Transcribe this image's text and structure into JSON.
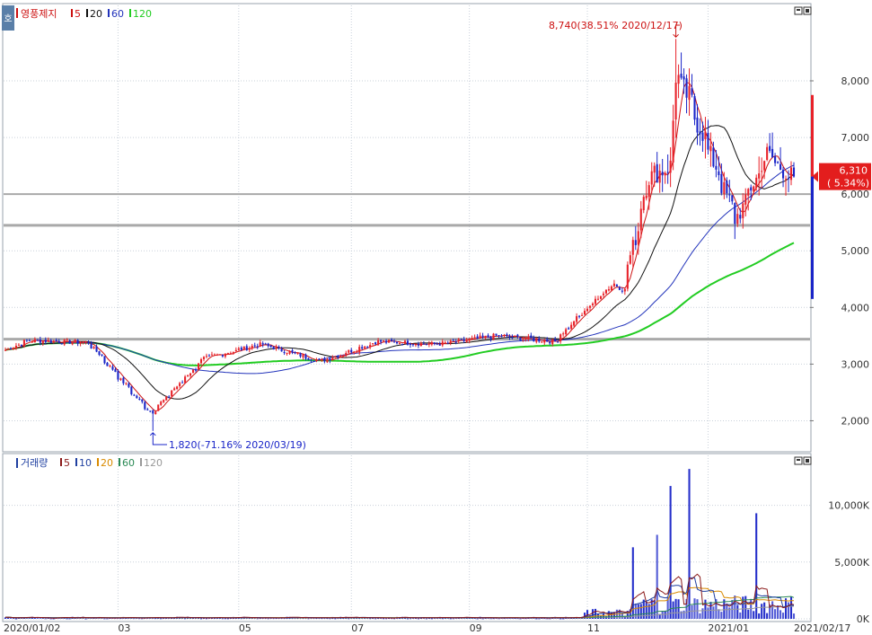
{
  "colors": {
    "up": "#e8222a",
    "down": "#1a25c8",
    "ma5": "#cc1111",
    "ma20": "#111111",
    "ma60": "#2233bb",
    "ma120": "#22cc22",
    "vol_ma5": "#8b1a1a",
    "vol_ma10": "#1f3fa0",
    "vol_ma20": "#d98a00",
    "vol_ma60": "#2a8a55",
    "vol_ma120": "#999999",
    "hline": "#a9a9a9",
    "grid": "#c9d0da",
    "current_price_bg": "#e31d1d"
  },
  "price_panel": {
    "stock_name": "영풍제지",
    "legend": [
      {
        "label": "5",
        "color": "#cc1111"
      },
      {
        "label": "20",
        "color": "#111111"
      },
      {
        "label": "60",
        "color": "#2233bb"
      },
      {
        "label": "120",
        "color": "#22cc22"
      }
    ],
    "badge": "호",
    "high_annotation": "8,740(38.51% 2020/12/17)",
    "low_annotation": "1,820(-71.16% 2020/03/19)",
    "current_price": "6,310",
    "current_change": "( 5.34%)",
    "y_ticks": [
      "8,000",
      "7,000",
      "6,000",
      "5,000",
      "4,000",
      "3,000",
      "2,000"
    ],
    "horizontal_lines": [
      {
        "value": 6000,
        "kind": "thin"
      },
      {
        "value": 5450,
        "kind": "thick"
      },
      {
        "value": 3440,
        "kind": "thick"
      }
    ]
  },
  "volume_panel": {
    "title": "거래량",
    "legend": [
      {
        "label": "5",
        "color": "#8b1a1a"
      },
      {
        "label": "10",
        "color": "#1f3fa0"
      },
      {
        "label": "20",
        "color": "#d98a00"
      },
      {
        "label": "60",
        "color": "#2a8a55"
      },
      {
        "label": "120",
        "color": "#999999"
      }
    ],
    "y_ticks": [
      "10,000K",
      "5,000K",
      "0K"
    ]
  },
  "x_axis": {
    "labels": [
      "2020/01/02",
      "03",
      "05",
      "07",
      "09",
      "11",
      "2021/01",
      "2021/02/17"
    ]
  },
  "chart_data": {
    "type": "candlestick",
    "x_range": [
      "2020/01/02",
      "2021/02/17"
    ],
    "price": {
      "ylim": [
        1500,
        9300
      ],
      "monthly_close_approx": [
        {
          "month": "2020/01",
          "close": 3420
        },
        {
          "month": "2020/02",
          "close": 3380
        },
        {
          "month": "2020/03",
          "close": 2250
        },
        {
          "month": "2020/04",
          "close": 3100
        },
        {
          "month": "2020/05",
          "close": 3350
        },
        {
          "month": "2020/06",
          "close": 3050
        },
        {
          "month": "2020/07",
          "close": 3400
        },
        {
          "month": "2020/08",
          "close": 3350
        },
        {
          "month": "2020/09",
          "close": 3500
        },
        {
          "month": "2020/10",
          "close": 3400
        },
        {
          "month": "2020/11",
          "close": 4450
        },
        {
          "month": "2020/12",
          "close": 6500
        },
        {
          "month": "2021/01",
          "close": 5800
        },
        {
          "month": "2021/02",
          "close": 6310
        }
      ],
      "high": {
        "value": 8740,
        "date": "2020/12/17",
        "change": "38.51%"
      },
      "low": {
        "value": 1820,
        "date": "2020/03/19",
        "change": "-71.16%"
      },
      "last": 6310
    },
    "volume": {
      "unit": "K",
      "ylim": [
        0,
        14000
      ],
      "peaks_approx": [
        {
          "date": "2020/11/25",
          "value": 6300
        },
        {
          "date": "2020/12/08",
          "value": 7400
        },
        {
          "date": "2020/12/15",
          "value": 11700
        },
        {
          "date": "2020/12/24",
          "value": 13200
        },
        {
          "date": "2021/01/28",
          "value": 9300
        }
      ]
    }
  }
}
